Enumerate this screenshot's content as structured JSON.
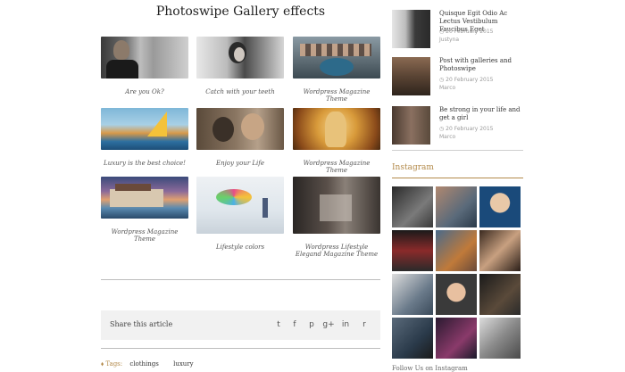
{
  "page": {
    "title": "Photoswipe Gallery effects"
  },
  "gallery": [
    {
      "caption": "Are you Ok?",
      "image": "portrait-man-suit"
    },
    {
      "caption": "Catch with your teeth",
      "image": "woman-bw-portrait"
    },
    {
      "caption": "Wordpress Magazine Theme",
      "image": "group-hands-together"
    },
    {
      "caption": "Luxury is the best choice!",
      "image": "sailboat-ocean"
    },
    {
      "caption": "Enjoy your Life",
      "image": "couple-embracing"
    },
    {
      "caption": "Wordpress Magazine Theme",
      "image": "blonde-woman-lights"
    },
    {
      "caption": "Wordpress Magazine Theme",
      "image": "luxury-house-sunset"
    },
    {
      "caption": "Lifestyle colors",
      "image": "paint-splash-person"
    },
    {
      "caption": "Wordpress Lifestyle Elegand Magazine Theme",
      "image": "cafe-table-glass"
    }
  ],
  "share": {
    "label": "Share this article",
    "icons": [
      "twitter-icon",
      "facebook-icon",
      "pinterest-icon",
      "google-plus-icon",
      "linkedin-icon",
      "reddit-icon"
    ],
    "glyphs": [
      "t",
      "f",
      "p",
      "g+",
      "in",
      "r"
    ]
  },
  "tags": {
    "label": "Tags:",
    "items": [
      "clothings",
      "luxury"
    ]
  },
  "sidebar": {
    "posts": [
      {
        "title": "Quisque Egit Odio Ac Lectus Vestibulum Faucibus Eget",
        "date": "20 February 2015",
        "author": "Justyna",
        "image": "man-portrait-bw"
      },
      {
        "title": "Post with galleries and Photoswipe",
        "date": "20 February 2015",
        "author": "Marco",
        "image": "man-in-suit"
      },
      {
        "title": "Be strong in your life and get a girl",
        "date": "20 February 2015",
        "author": "Marco",
        "image": "couple-glasses"
      }
    ],
    "instagram": {
      "heading": "Instagram",
      "follow": "Follow Us on Instagram"
    }
  },
  "colors": {
    "accent": "#b38a4a",
    "share_bg": "#f1f1f1",
    "divider": "#bdbdbd"
  }
}
